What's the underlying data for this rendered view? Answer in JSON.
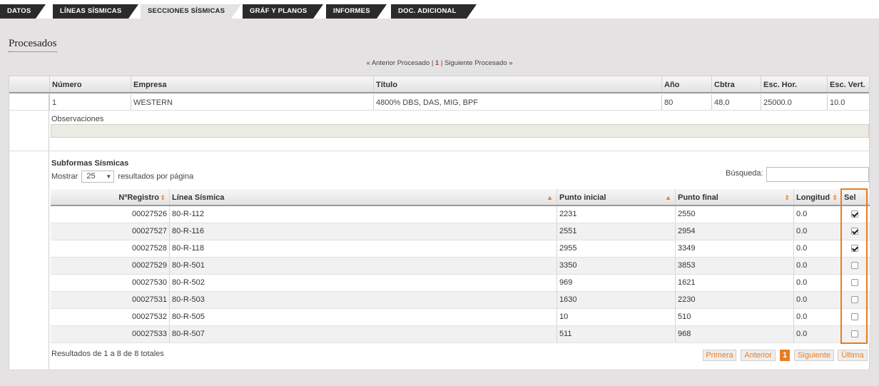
{
  "tabs": [
    {
      "label": "DATOS",
      "active": false
    },
    {
      "label": "LÍNEAS SÍSMICAS",
      "active": false
    },
    {
      "label": "SECCIONES SÍSMICAS",
      "active": true
    },
    {
      "label": "GRÁF Y PLANOS",
      "active": false
    },
    {
      "label": "INFORMES",
      "active": false
    },
    {
      "label": "DOC. ADICIONAL",
      "active": false
    }
  ],
  "section_title": "Procesados",
  "proc_nav": {
    "prev": "« Anterior Procesado",
    "sep": "|",
    "current": "1",
    "next": "Siguiente Procesado »"
  },
  "info": {
    "headers": [
      "Número",
      "Empresa",
      "Título",
      "Año",
      "Cbtra",
      "Esc. Hor.",
      "Esc. Vert."
    ],
    "row": [
      "1",
      "WESTERN",
      "4800% DBS, DAS, MIG, BPF",
      "80",
      "48.0",
      "25000.0",
      "10.0"
    ],
    "observaciones_label": "Observaciones",
    "observaciones_value": ""
  },
  "subformas": {
    "title": "Subformas Sísmicas",
    "mostrar_label": "Mostrar",
    "page_size": "25",
    "page_size_suffix": "resultados por página",
    "busqueda_label": "Búsqueda:",
    "busqueda_value": "",
    "headers": [
      "NºRegistro",
      "Línea Sísmica",
      "Punto inicial",
      "Punto final",
      "Longitud",
      "Sel"
    ],
    "rows": [
      {
        "registro": "00027526",
        "linea": "80-R-112",
        "inicial": "2231",
        "final": "2550",
        "longitud": "0.0",
        "sel": true
      },
      {
        "registro": "00027527",
        "linea": "80-R-116",
        "inicial": "2551",
        "final": "2954",
        "longitud": "0.0",
        "sel": true
      },
      {
        "registro": "00027528",
        "linea": "80-R-118",
        "inicial": "2955",
        "final": "3349",
        "longitud": "0.0",
        "sel": true
      },
      {
        "registro": "00027529",
        "linea": "80-R-501",
        "inicial": "3350",
        "final": "3853",
        "longitud": "0.0",
        "sel": false
      },
      {
        "registro": "00027530",
        "linea": "80-R-502",
        "inicial": "969",
        "final": "1621",
        "longitud": "0.0",
        "sel": false
      },
      {
        "registro": "00027531",
        "linea": "80-R-503",
        "inicial": "1630",
        "final": "2230",
        "longitud": "0.0",
        "sel": false
      },
      {
        "registro": "00027532",
        "linea": "80-R-505",
        "inicial": "10",
        "final": "510",
        "longitud": "0.0",
        "sel": false
      },
      {
        "registro": "00027533",
        "linea": "80-R-507",
        "inicial": "511",
        "final": "968",
        "longitud": "0.0",
        "sel": false
      }
    ],
    "results_text": "Resultados de 1 a 8 de 8 totales",
    "pagination": {
      "first": "Primera",
      "prev": "Anterior",
      "current": "1",
      "next": "Siguiente",
      "last": "Última"
    }
  },
  "colors": {
    "accent": "#e67e22",
    "tab_bg": "#2b2b2b",
    "highlight_border": "#e67e22"
  }
}
